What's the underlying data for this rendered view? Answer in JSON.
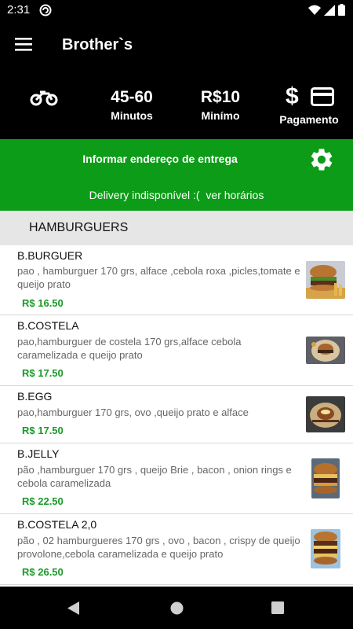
{
  "status": {
    "time": "2:31"
  },
  "appbar": {
    "title": "Brother`s"
  },
  "info": {
    "time_value": "45-60",
    "time_label": "Minutos",
    "min_value": "R$10",
    "min_label": "Minímo",
    "payment_label": "Pagamento"
  },
  "delivery": {
    "address_label": "Informar endereço de entrega",
    "status_text": "Delivery indisponível :(",
    "hours_link": "ver horários"
  },
  "category": {
    "name": "HAMBURGUERS"
  },
  "items": [
    {
      "name": "B.BURGUER",
      "desc": "pao , hamburguer 170 grs, alface ,cebola roxa ,picles,tomate e queijo prato",
      "price": "R$ 16.50"
    },
    {
      "name": "B.COSTELA",
      "desc": "pao,hamburguer de costela 170 grs,alface cebola caramelizada e queijo prato",
      "price": "R$ 17.50"
    },
    {
      "name": "B.EGG",
      "desc": "pao,hamburguer 170 grs, ovo ,queijo prato e alface",
      "price": "R$ 17.50"
    },
    {
      "name": "B.JELLY",
      "desc": "pão ,hamburguer 170 grs , queijo Brie , bacon , onion rings e cebola caramelizada",
      "price": "R$ 22.50"
    },
    {
      "name": "B.COSTELA 2,0",
      "desc": "pão , 02 hamburgueres 170 grs , ovo , bacon , crispy de queijo provolone,cebola caramelizada e queijo prato",
      "price": "R$ 26.50"
    }
  ],
  "colors": {
    "green": "#0c9c17",
    "price_green": "#1a9a2a"
  },
  "icons": [
    "menu-icon",
    "motorcycle-icon",
    "dollar-icon",
    "credit-card-icon",
    "gear-icon",
    "back-icon",
    "home-icon",
    "recents-icon"
  ]
}
